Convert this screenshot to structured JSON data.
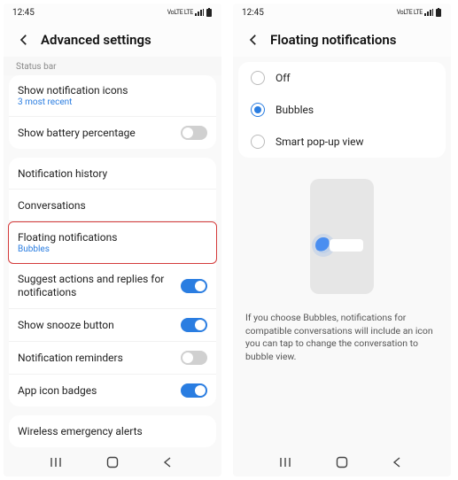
{
  "status": {
    "time": "12:45",
    "netText": "VoLTE LTE"
  },
  "left": {
    "title": "Advanced settings",
    "statusbarHdr": "Status bar",
    "rows": {
      "icons": {
        "t": "Show notification icons",
        "s": "3 most recent"
      },
      "battery": {
        "t": "Show battery percentage"
      },
      "history": {
        "t": "Notification history"
      },
      "convo": {
        "t": "Conversations"
      },
      "floating": {
        "t": "Floating notifications",
        "s": "Bubbles"
      },
      "suggest": {
        "t": "Suggest actions and replies for notifications"
      },
      "snooze": {
        "t": "Show snooze button"
      },
      "reminders": {
        "t": "Notification reminders"
      },
      "badges": {
        "t": "App icon badges"
      },
      "alerts": {
        "t": "Wireless emergency alerts"
      }
    }
  },
  "right": {
    "title": "Floating notifications",
    "options": {
      "off": "Off",
      "bubbles": "Bubbles",
      "popup": "Smart pop-up view"
    },
    "desc": "If you choose Bubbles, notifications for compatible conversations will include an icon you can tap to change the conversation to bubble view."
  }
}
